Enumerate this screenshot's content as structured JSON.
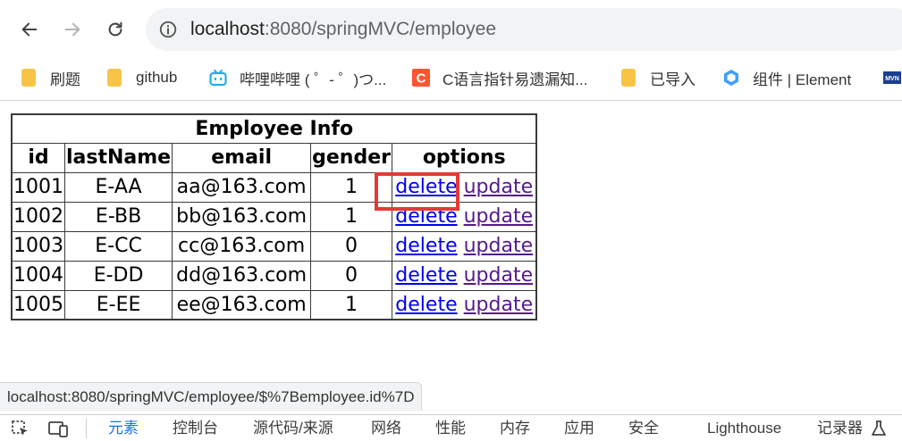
{
  "browser": {
    "url_host": "localhost",
    "url_rest": ":8080/springMVC/employee"
  },
  "bookmarks": [
    {
      "label": "刷题",
      "icon": "folder-icon"
    },
    {
      "label": "github",
      "icon": "folder-icon"
    },
    {
      "label": "哔哩哔哩 ( ゜- ゜)つ...",
      "icon": "bilibili-icon"
    },
    {
      "label": "C语言指针易遗漏知...",
      "icon": "c-site-icon"
    },
    {
      "label": "已导入",
      "icon": "folder-icon"
    },
    {
      "label": "组件 | Element",
      "icon": "element-icon"
    }
  ],
  "table": {
    "caption": "Employee Info",
    "headers": [
      "id",
      "lastName",
      "email",
      "gender",
      "options"
    ],
    "rows": [
      {
        "id": "1001",
        "lastName": "E-AA",
        "email": "aa@163.com",
        "gender": "1",
        "delete": "delete",
        "update": "update"
      },
      {
        "id": "1002",
        "lastName": "E-BB",
        "email": "bb@163.com",
        "gender": "1",
        "delete": "delete",
        "update": "update"
      },
      {
        "id": "1003",
        "lastName": "E-CC",
        "email": "cc@163.com",
        "gender": "0",
        "delete": "delete",
        "update": "update"
      },
      {
        "id": "1004",
        "lastName": "E-DD",
        "email": "dd@163.com",
        "gender": "0",
        "delete": "delete",
        "update": "update"
      },
      {
        "id": "1005",
        "lastName": "E-EE",
        "email": "ee@163.com",
        "gender": "1",
        "delete": "delete",
        "update": "update"
      }
    ]
  },
  "status_url": "localhost:8080/springMVC/employee/$%7Bemployee.id%7D",
  "devtools": {
    "tabs": [
      "元素",
      "控制台",
      "源代码/来源",
      "网络",
      "性能",
      "内存",
      "应用",
      "安全",
      "Lighthouse",
      "记录器"
    ],
    "active_tab": "元素"
  },
  "colors": {
    "link": "#0000ee",
    "visited_link": "#551a8b",
    "highlight_box": "#e53935",
    "devtools_active": "#1a73e8"
  }
}
